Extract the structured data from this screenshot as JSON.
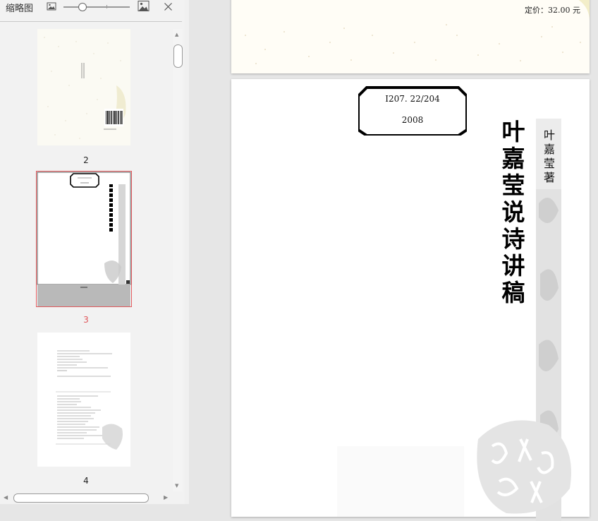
{
  "panel": {
    "title": "缩略图",
    "icons": [
      "image-small-icon",
      "image-large-icon",
      "close-icon"
    ],
    "zoom_level": 0.33
  },
  "thumbnails": [
    {
      "page_number": "2",
      "active": false
    },
    {
      "page_number": "3",
      "active": true
    },
    {
      "page_number": "4",
      "active": false
    }
  ],
  "document": {
    "price": "定价：32.00 元",
    "call_number_line1": "I207. 22/204",
    "call_number_line2": "2008",
    "book_title": "叶嘉莹说诗讲稿",
    "author": "叶嘉莹 著"
  },
  "colors": {
    "active_accent": "#e0575b",
    "panel_bg": "#f2f2f2",
    "viewport_bg": "#e6e6e6"
  }
}
